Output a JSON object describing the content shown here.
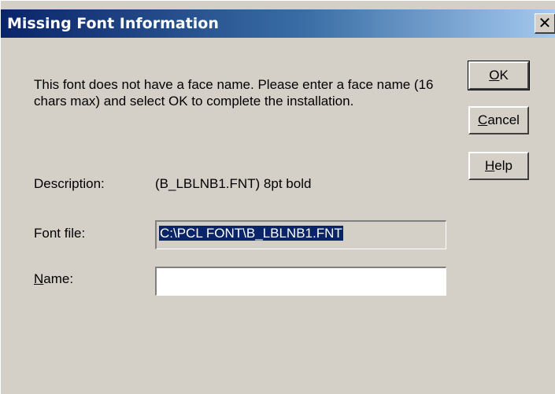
{
  "window": {
    "title": "Missing Font Information",
    "close_glyph": "✕"
  },
  "message": "This font does not have a face name. Please enter a face name (16 chars max) and select OK to complete the installation.",
  "buttons": {
    "ok": {
      "mnemonic": "O",
      "rest": "K"
    },
    "cancel": {
      "mnemonic": "C",
      "rest": "ancel"
    },
    "help": {
      "mnemonic": "H",
      "rest": "elp"
    }
  },
  "description": {
    "label": "Description:",
    "value": "(B_LBLNB1.FNT) 8pt  bold"
  },
  "font_file": {
    "label": "Font file:",
    "value": "C:\\PCL FONT\\B_LBLNB1.FNT"
  },
  "name": {
    "label_mnemonic": "N",
    "label_rest": "ame:",
    "value": ""
  },
  "colors": {
    "dialog_bg": "#d4d0c8",
    "titlebar_start": "#0a246a",
    "titlebar_end": "#a6caf0",
    "selection_bg": "#0a246a"
  }
}
